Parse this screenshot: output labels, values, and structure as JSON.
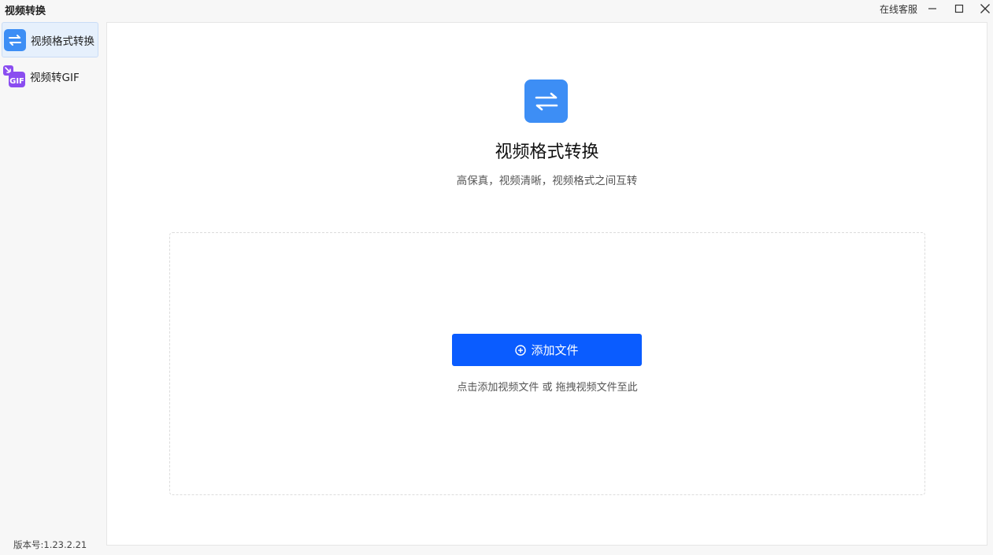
{
  "window": {
    "title": "视频转换",
    "support_label": "在线客服"
  },
  "sidebar": {
    "items": [
      {
        "label": "视频格式转换",
        "icon": "swap-arrows-icon",
        "active": true
      },
      {
        "label": "视频转GIF",
        "icon": "gif-icon",
        "active": false
      }
    ],
    "version": "版本号:1.23.2.21"
  },
  "main": {
    "title": "视频格式转换",
    "subtitle": "高保真，视频清晰，视频格式之间互转",
    "add_button_label": "添加文件",
    "drop_hint": "点击添加视频文件 或 拖拽视频文件至此"
  },
  "colors": {
    "accent": "#0a5cff",
    "icon_blue": "#3d8ef5",
    "gif_purple": "#8a4df0"
  }
}
